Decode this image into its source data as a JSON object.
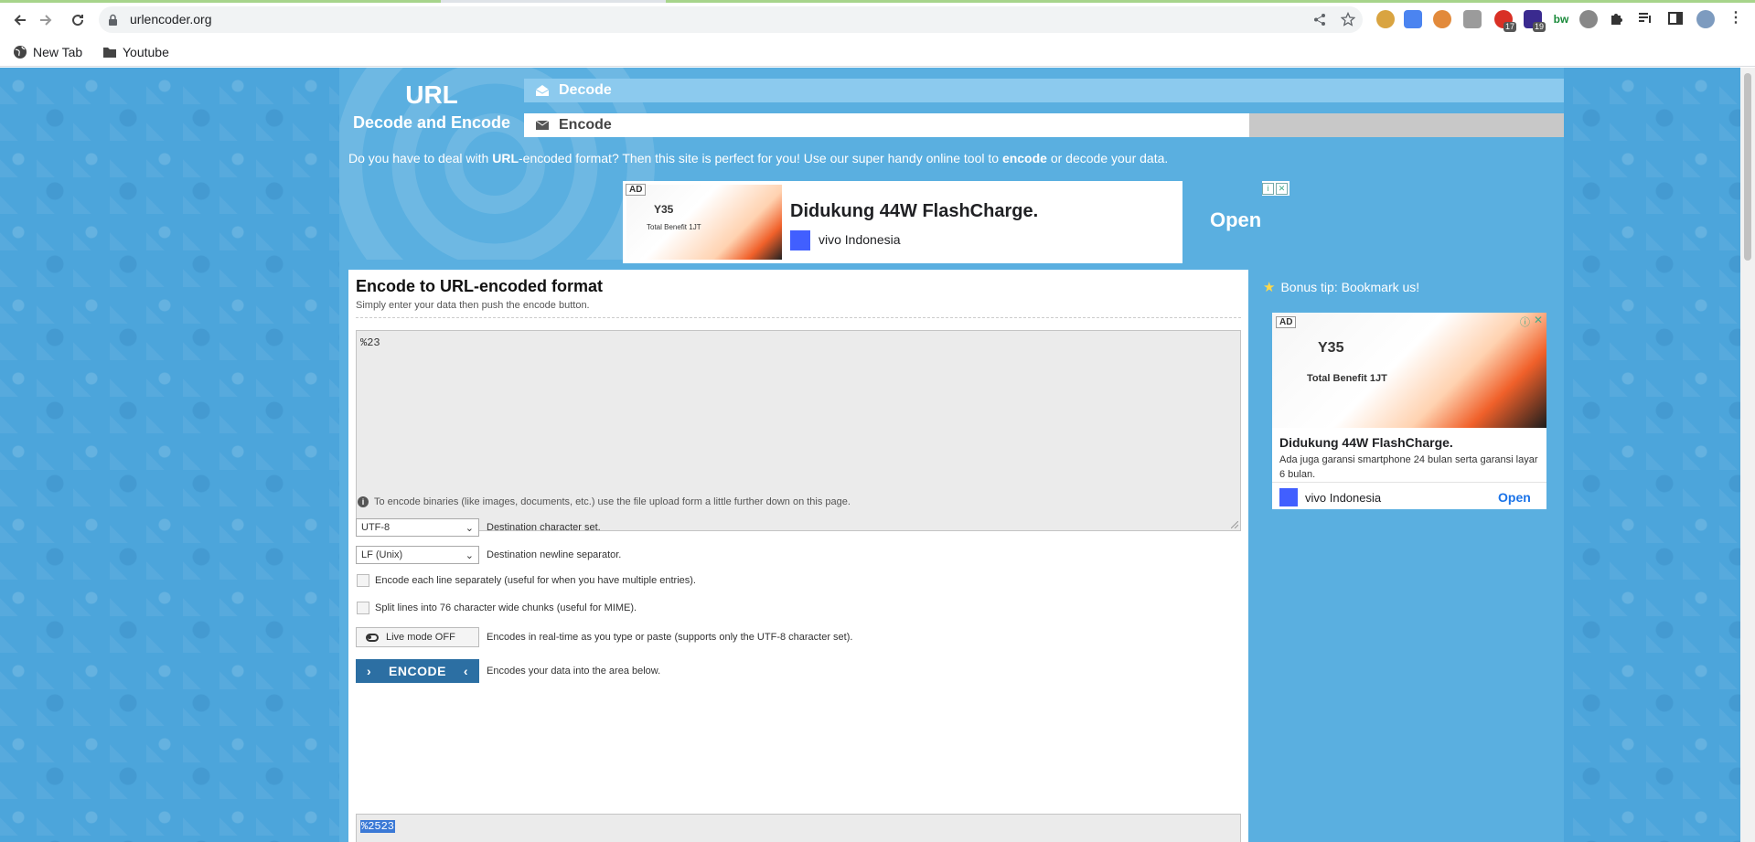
{
  "browser": {
    "url": "urlencoder.org",
    "bookmarks": [
      "New Tab",
      "Youtube"
    ],
    "extension_badges": [
      "17",
      "19"
    ]
  },
  "site": {
    "logo_title": "URL",
    "logo_subtitle": "Decode and Encode",
    "nav": {
      "decode": "Decode",
      "encode": "Encode"
    },
    "intro": {
      "part1": "Do you have to deal with ",
      "bold1": "URL",
      "part2": "-encoded format? Then this site is perfect for you! Use our super handy online tool to ",
      "bold2": "encode",
      "part3": " or decode your data."
    }
  },
  "ad_top": {
    "badge": "AD",
    "headline": "Didukung 44W FlashCharge.",
    "brand": "vivo Indonesia",
    "cta": "Open",
    "product": "Y35",
    "benefit": "Total Benefit 1JT"
  },
  "encoder": {
    "title": "Encode to URL-encoded format",
    "subtitle": "Simply enter your data then push the encode button.",
    "input_value": "%23",
    "binary_hint": "To encode binaries (like images, documents, etc.) use the file upload form a little further down on this page.",
    "charset": {
      "value": "UTF-8",
      "label": "Destination character set."
    },
    "newline": {
      "value": "LF (Unix)",
      "label": "Destination newline separator."
    },
    "each_line_label": "Encode each line separately (useful for when you have multiple entries).",
    "split_label": "Split lines into 76 character wide chunks (useful for MIME).",
    "live_mode": {
      "button": "Live mode OFF",
      "label": "Encodes in real-time as you type or paste (supports only the UTF-8 character set)."
    },
    "encode": {
      "button": "ENCODE",
      "label": "Encodes your data into the area below."
    },
    "output_value": "%2523"
  },
  "sidebar": {
    "tip": "Bonus tip: Bookmark us!",
    "ad": {
      "badge": "AD",
      "product": "Y35",
      "benefit": "Total Benefit 1JT",
      "headline": "Didukung 44W FlashCharge.",
      "description": "Ada juga garansi smartphone 24 bulan serta garansi layar 6 bulan.",
      "brand": "vivo Indonesia",
      "cta": "Open"
    }
  },
  "colors": {
    "page_bg": "#4ca5db",
    "content_bg": "#5aafe0",
    "encode_button": "#2c6fa3",
    "selection": "#3b79d6"
  }
}
